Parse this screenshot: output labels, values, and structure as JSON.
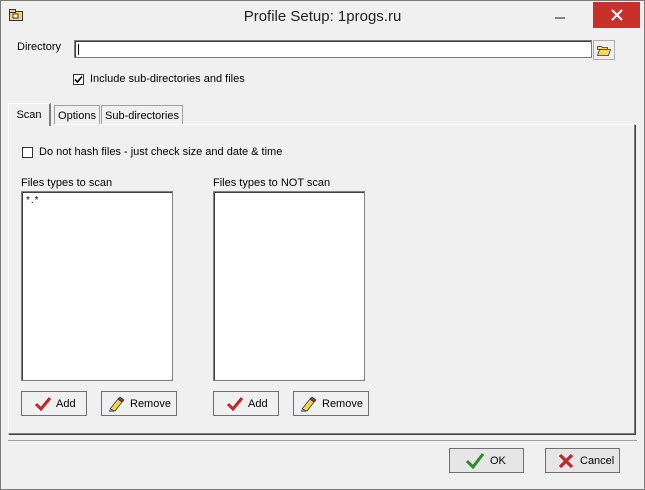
{
  "window": {
    "title": "Profile Setup: 1progs.ru"
  },
  "directory": {
    "label": "Directory",
    "value": ""
  },
  "include_subdirs": {
    "label": "Include sub-directories and files",
    "checked": true
  },
  "tabs": [
    {
      "label": "Scan",
      "active": true
    },
    {
      "label": "Options",
      "active": false
    },
    {
      "label": "Sub-directories",
      "active": false
    }
  ],
  "scan": {
    "no_hash": {
      "label": "Do not hash files - just check size and date & time",
      "checked": false
    },
    "include_list": {
      "label": "Files types to scan",
      "items": [
        "*.*"
      ]
    },
    "exclude_list": {
      "label": "Files types to NOT scan",
      "items": []
    },
    "add_label": "Add",
    "remove_label": "Remove"
  },
  "footer": {
    "ok_label": "OK",
    "cancel_label": "Cancel"
  },
  "colors": {
    "close_button": "#c7312a",
    "ok_check": "#2e8b2e",
    "cancel_x": "#c0282d",
    "add_check": "#c0282d"
  }
}
